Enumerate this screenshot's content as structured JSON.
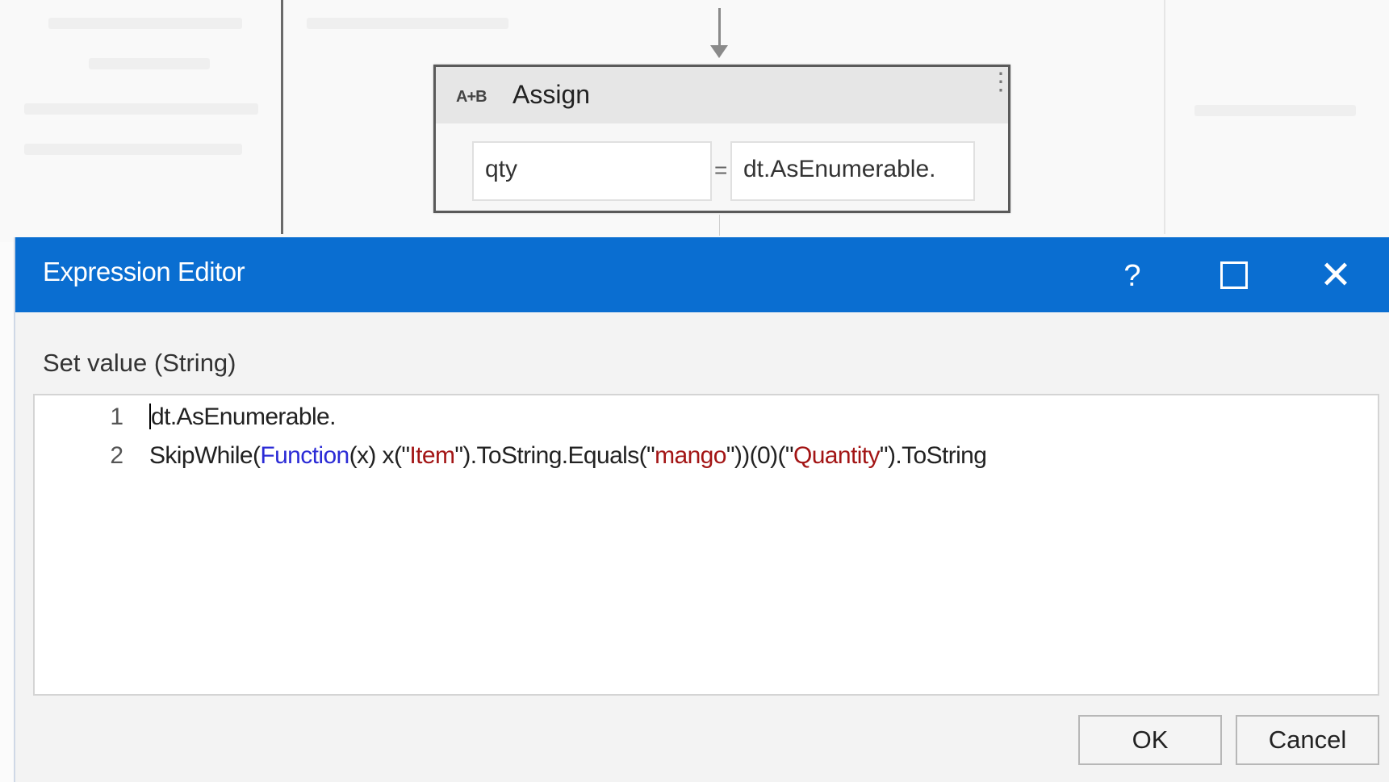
{
  "designer": {
    "activity": {
      "icon": "A+B",
      "title": "Assign",
      "to_value": "qty",
      "equals": "=",
      "value_preview": "dt.AsEnumerable."
    }
  },
  "dialog": {
    "title": "Expression Editor",
    "help_glyph": "?",
    "close_glyph": "✕",
    "label": "Set value (String)",
    "code_lines": [
      {
        "number": "1",
        "text": "dt.AsEnumerable."
      },
      {
        "number": "2",
        "tokens": [
          {
            "text": "SkipWhile(",
            "kind": "plain"
          },
          {
            "text": "Function",
            "kind": "keyword"
          },
          {
            "text": "(x) x(\"",
            "kind": "plain"
          },
          {
            "text": "Item",
            "kind": "string"
          },
          {
            "text": "\").ToString.Equals(\"",
            "kind": "plain"
          },
          {
            "text": "mango",
            "kind": "string"
          },
          {
            "text": "\"))(0)(\"",
            "kind": "plain"
          },
          {
            "text": "Quantity",
            "kind": "string"
          },
          {
            "text": "\").ToString",
            "kind": "plain"
          }
        ]
      }
    ],
    "ok_label": "OK",
    "cancel_label": "Cancel"
  },
  "colors": {
    "titlebar": "#0a6ed1",
    "keyword": "#2b2bd6",
    "string": "#a31515"
  }
}
